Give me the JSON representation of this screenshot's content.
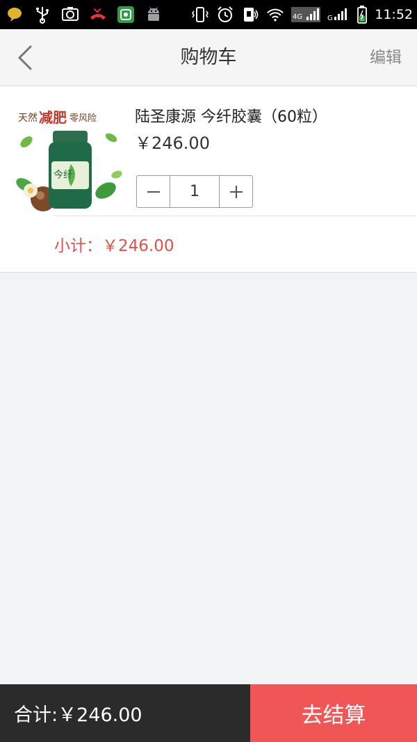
{
  "status_bar": {
    "time": "11:52",
    "network_label": "4G",
    "network_label_2": "G",
    "left_icons": [
      "chat-bubble-icon",
      "usb-icon",
      "screenshot-icon",
      "missed-call-icon",
      "app-store-icon",
      "android-icon"
    ],
    "right_icons": [
      "vibrate-icon",
      "alarm-icon",
      "nfc-icon",
      "wifi-icon",
      "signal-icon",
      "signal-icon",
      "battery-icon"
    ]
  },
  "nav": {
    "back_icon": "chevron-left-icon",
    "title": "购物车",
    "edit_label": "编辑"
  },
  "cart": {
    "items": [
      {
        "name": "陆圣康源 今纤胶囊（60粒）",
        "price": "￥246.00",
        "quantity": "1",
        "decrease_label": "−",
        "increase_label": "+",
        "subtotal_label": "小计：",
        "subtotal_value": "￥246.00",
        "image_text": {
          "headline_1": "天然",
          "headline_2": "减肥",
          "headline_3": "零风险",
          "bottle_label": "今纤"
        }
      }
    ]
  },
  "footer": {
    "total_label": "合计:",
    "total_value": "￥246.00",
    "checkout_label": "去结算"
  },
  "colors": {
    "accent": "#f05655",
    "subtotal_text": "#e0504d",
    "footer_dark": "#2b2b2b",
    "statusbar": "#000000"
  }
}
